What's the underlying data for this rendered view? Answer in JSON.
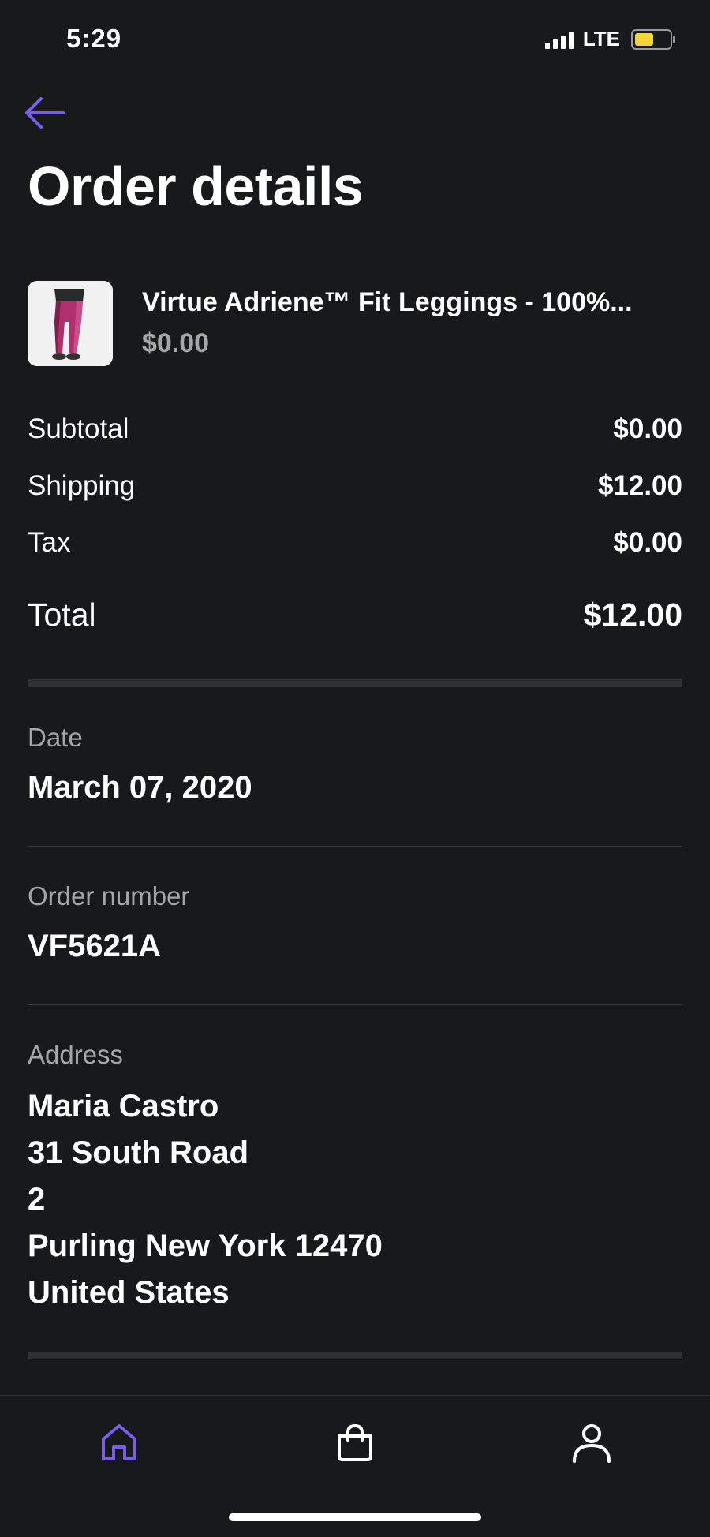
{
  "status_bar": {
    "time": "5:29",
    "network": "LTE",
    "battery_level": 0.55,
    "battery_color": "#f2d33a"
  },
  "header": {
    "back_icon": "arrow-left-icon",
    "title": "Order details",
    "accent": "#7b5cf0"
  },
  "product": {
    "name": "Virtue Adriene™ Fit Leggings - 100%...",
    "price": "$0.00"
  },
  "summary": {
    "subtotal": {
      "label": "Subtotal",
      "value": "$0.00"
    },
    "shipping": {
      "label": "Shipping",
      "value": "$12.00"
    },
    "tax": {
      "label": "Tax",
      "value": "$0.00"
    },
    "total": {
      "label": "Total",
      "value": "$12.00"
    }
  },
  "details": {
    "date": {
      "label": "Date",
      "value": "March 07, 2020"
    },
    "order_number": {
      "label": "Order number",
      "value": "VF5621A"
    },
    "address": {
      "label": "Address",
      "lines": [
        "Maria Castro",
        "31 South Road",
        "2",
        "Purling New York 12470",
        "United States"
      ]
    }
  },
  "tabbar": {
    "items": [
      {
        "icon": "home-icon",
        "active": true
      },
      {
        "icon": "shopping-bag-icon",
        "active": false
      },
      {
        "icon": "profile-icon",
        "active": false
      }
    ],
    "active_color": "#7b5cf0"
  }
}
